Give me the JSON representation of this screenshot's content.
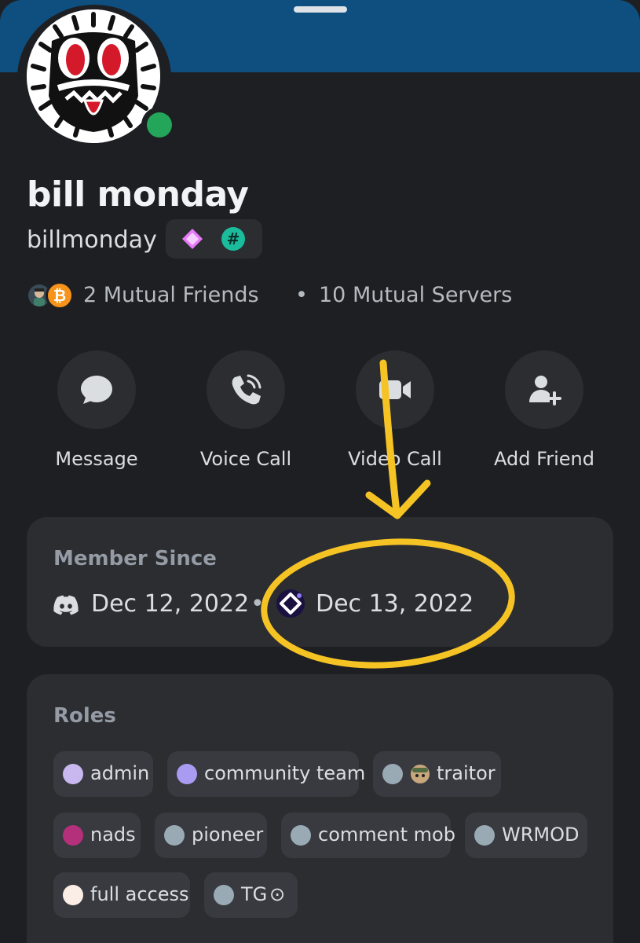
{
  "profile": {
    "display_name": "bill monday",
    "username": "billmonday",
    "status": "online",
    "badges": [
      "nitro-gem-icon",
      "hashtag-badge-icon"
    ],
    "hash_badge_glyph": "#"
  },
  "mutual": {
    "friends": "2 Mutual Friends",
    "separator": "•",
    "servers": "10 Mutual Servers",
    "avatar_glyph": "₿"
  },
  "actions": {
    "message": "Message",
    "voice_call": "Voice Call",
    "video_call": "Video Call",
    "add_friend": "Add Friend"
  },
  "member_since": {
    "title": "Member Since",
    "discord_date": "Dec 12, 2022",
    "separator": "•",
    "server_date": "Dec 13, 2022"
  },
  "roles": {
    "title": "Roles",
    "items": [
      {
        "name": "admin",
        "color": "#c9b8f0"
      },
      {
        "name": "community team",
        "color": "#a99af2"
      },
      {
        "name": "traitor",
        "color": "#99aab5",
        "has_emoji": true
      },
      {
        "name": "nads",
        "color": "#b5307a"
      },
      {
        "name": "pioneer",
        "color": "#99aab5"
      },
      {
        "name": "comment mob",
        "color": "#99aab5"
      },
      {
        "name": "WRMOD",
        "color": "#99aab5"
      },
      {
        "name": "full access",
        "color": "#fbeee6"
      },
      {
        "name": "TG",
        "color": "#99aab5",
        "suffix": "⊙"
      }
    ]
  },
  "colors": {
    "banner": "#0e4f80",
    "annotation": "#f6c325",
    "online": "#23a55a"
  }
}
